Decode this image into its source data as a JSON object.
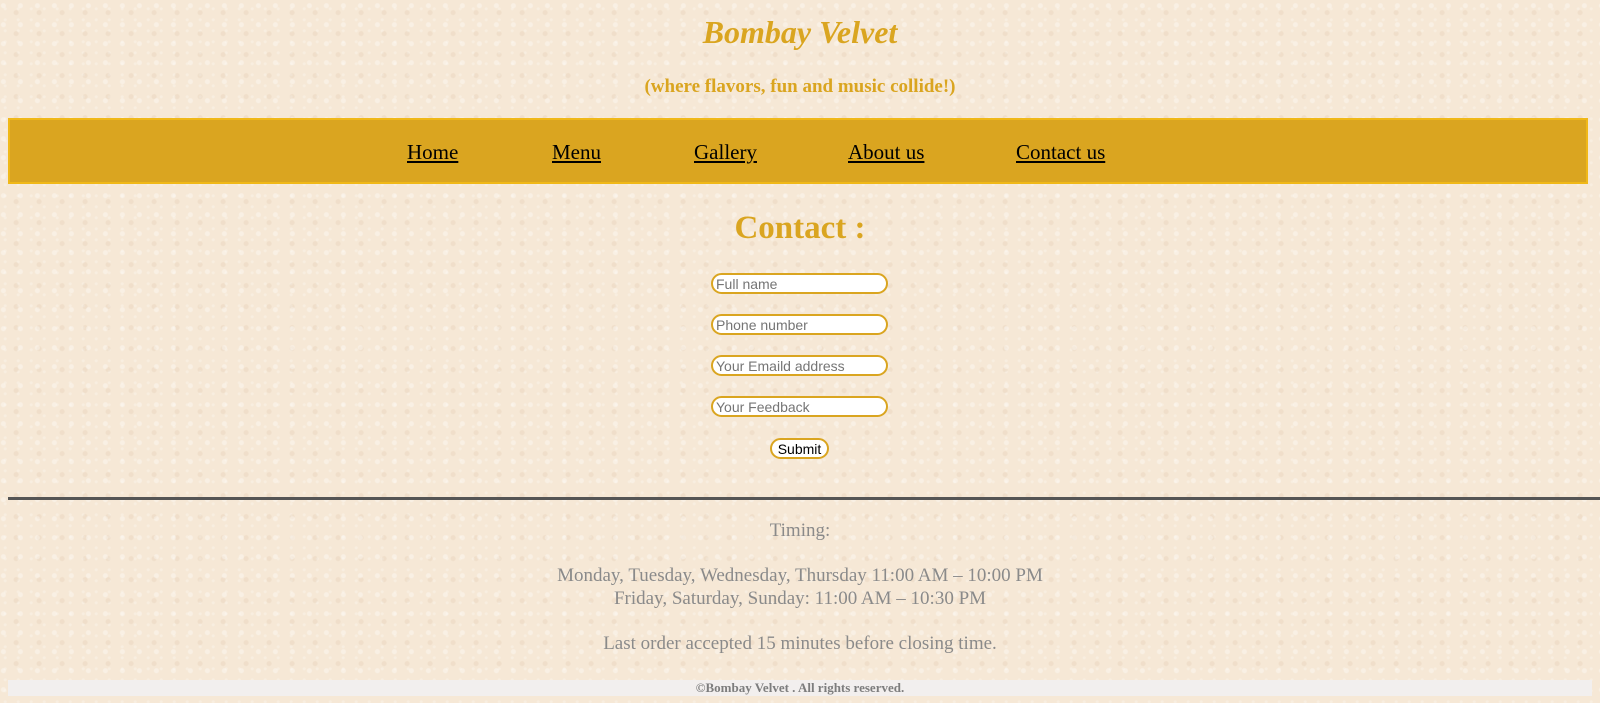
{
  "header": {
    "title": "Bombay Velvet",
    "tagline": "(where flavors, fun and music collide!)"
  },
  "nav": {
    "items": [
      {
        "label": "Home"
      },
      {
        "label": "Menu"
      },
      {
        "label": "Gallery"
      },
      {
        "label": "About us"
      },
      {
        "label": "Contact us"
      }
    ]
  },
  "contact": {
    "heading": "Contact :",
    "full_name": {
      "placeholder": "Full name",
      "value": ""
    },
    "phone": {
      "placeholder": "Phone number",
      "value": ""
    },
    "email": {
      "placeholder": "Your Emaild address",
      "value": ""
    },
    "feedback": {
      "placeholder": "Your Feedback",
      "value": ""
    },
    "submit_label": "Submit"
  },
  "timing": {
    "heading": "Timing:",
    "weekdays": "Monday, Tuesday, Wednesday, Thursday 11:00 AM – 10:00 PM",
    "weekend": "Friday, Saturday, Sunday: 11:00 AM – 10:30 PM",
    "last_order": "Last order accepted 15 minutes before closing time."
  },
  "footer": {
    "copyright": "©Bombay Velvet . All rights reserved."
  },
  "colors": {
    "accent": "#daa520",
    "background": "#f6e8d6",
    "divider": "#555555",
    "muted_text": "#8a8a8a"
  }
}
